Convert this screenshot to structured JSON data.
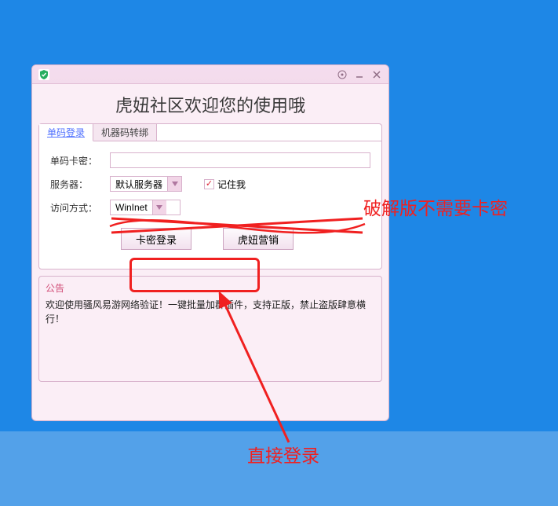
{
  "titlebar": {
    "title": ""
  },
  "headline": "虎妞社区欢迎您的使用哦",
  "tabs": {
    "login": "单码登录",
    "rebind": "机器码转绑"
  },
  "form": {
    "cardLabel": "单码卡密：",
    "cardValue": "",
    "serverLabel": "服务器：",
    "serverValue": "默认服务器",
    "rememberLabel": "记住我",
    "rememberChecked": true,
    "accessLabel": "访问方式：",
    "accessValue": "WinInet"
  },
  "buttons": {
    "login": "卡密登录",
    "marketing": "虎妞营销"
  },
  "announce": {
    "title": "公告",
    "text": "欢迎使用骚风易游网络验证！一键批量加群插件，支持正版，禁止盗版肆意横行！"
  },
  "annotations": {
    "noNeed": "破解版不需要卡密",
    "direct": "直接登录"
  }
}
